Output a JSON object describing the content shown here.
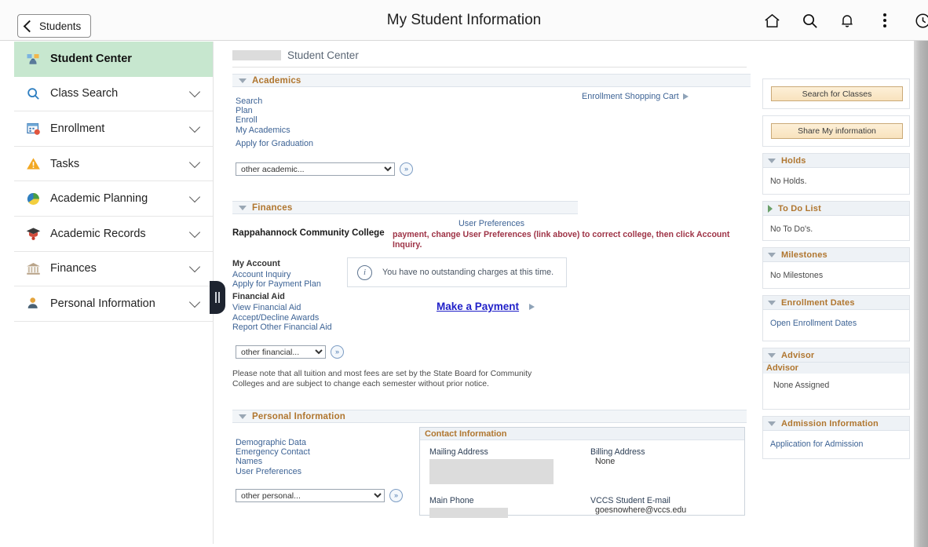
{
  "header": {
    "back_label": "Students",
    "title": "My Student Information",
    "icons": [
      "home-icon",
      "search-icon",
      "bell-icon",
      "kebab-menu-icon",
      "clock-icon"
    ]
  },
  "sidebar": {
    "items": [
      {
        "label": "Student Center",
        "icon": "student-center-icon",
        "active": true,
        "expandable": false
      },
      {
        "label": "Class Search",
        "icon": "magnifier-icon",
        "active": false,
        "expandable": true
      },
      {
        "label": "Enrollment",
        "icon": "calendar-icon",
        "active": false,
        "expandable": true
      },
      {
        "label": "Tasks",
        "icon": "warning-triangle-icon",
        "active": false,
        "expandable": true
      },
      {
        "label": "Academic Planning",
        "icon": "pie-chart-icon",
        "active": false,
        "expandable": true
      },
      {
        "label": "Academic Records",
        "icon": "graduate-icon",
        "active": false,
        "expandable": true
      },
      {
        "label": "Finances",
        "icon": "bank-icon",
        "active": false,
        "expandable": true
      },
      {
        "label": "Personal Information",
        "icon": "person-icon",
        "active": false,
        "expandable": true
      }
    ]
  },
  "breadcrumb": {
    "redacted": "",
    "text": "Student Center"
  },
  "academics": {
    "title": "Academics",
    "links": [
      "Search",
      "Plan",
      "Enroll",
      "My Academics"
    ],
    "graduation_link": "Apply for Graduation",
    "shopping_cart_link": "Enrollment Shopping Cart",
    "dropdown_value": "other academic...",
    "go_label": "»"
  },
  "finances": {
    "title": "Finances",
    "user_preferences_link": "User Preferences",
    "college_name": "Rappahannock Community College",
    "warning": "payment, change User Preferences (link above) to correct college, then click Account Inquiry.",
    "my_account_label": "My Account",
    "my_account_links": [
      "Account Inquiry",
      "Apply for Payment Plan"
    ],
    "financial_aid_label": "Financial Aid",
    "financial_aid_links": [
      "View Financial Aid",
      "Accept/Decline Awards",
      "Report Other Financial Aid"
    ],
    "info_message": "You have no outstanding charges at this time.",
    "make_payment_link": "Make a Payment",
    "dropdown_value": "other financial...",
    "go_label": "»",
    "note": "Please note that all tuition and most fees are set by the State Board for Community Colleges and are subject to change each semester without prior notice."
  },
  "personal_information": {
    "title": "Personal Information",
    "links": [
      "Demographic Data",
      "Emergency Contact",
      "Names",
      "User Preferences"
    ],
    "dropdown_value": "other personal...",
    "go_label": "»",
    "contact": {
      "title": "Contact Information",
      "mailing_address_label": "Mailing Address",
      "mailing_address_value": "",
      "billing_address_label": "Billing Address",
      "billing_address_value": "None",
      "main_phone_label": "Main Phone",
      "main_phone_value": "",
      "email_label": "VCCS Student E-mail",
      "email_value": "goesnowhere@vccs.edu"
    }
  },
  "rail": {
    "search_classes_button": "Search for Classes",
    "share_info_button": "Share My information",
    "holds": {
      "title": "Holds",
      "body": "No Holds."
    },
    "todo": {
      "title": "To Do List",
      "body": "No To Do's."
    },
    "milestones": {
      "title": "Milestones",
      "body": "No Milestones"
    },
    "enrollment_dates": {
      "title": "Enrollment Dates",
      "link": "Open Enrollment Dates"
    },
    "advisor": {
      "title": "Advisor",
      "subhead": "Advisor",
      "body": "None Assigned"
    },
    "admission": {
      "title": "Admission Information",
      "link": "Application for Admission"
    }
  },
  "colors": {
    "accent_green": "#c7e7cf",
    "section_title": "#b0762f",
    "link_blue": "#3d6395",
    "warning_red": "#9e3346",
    "button_gold": "#f8e2bd"
  }
}
